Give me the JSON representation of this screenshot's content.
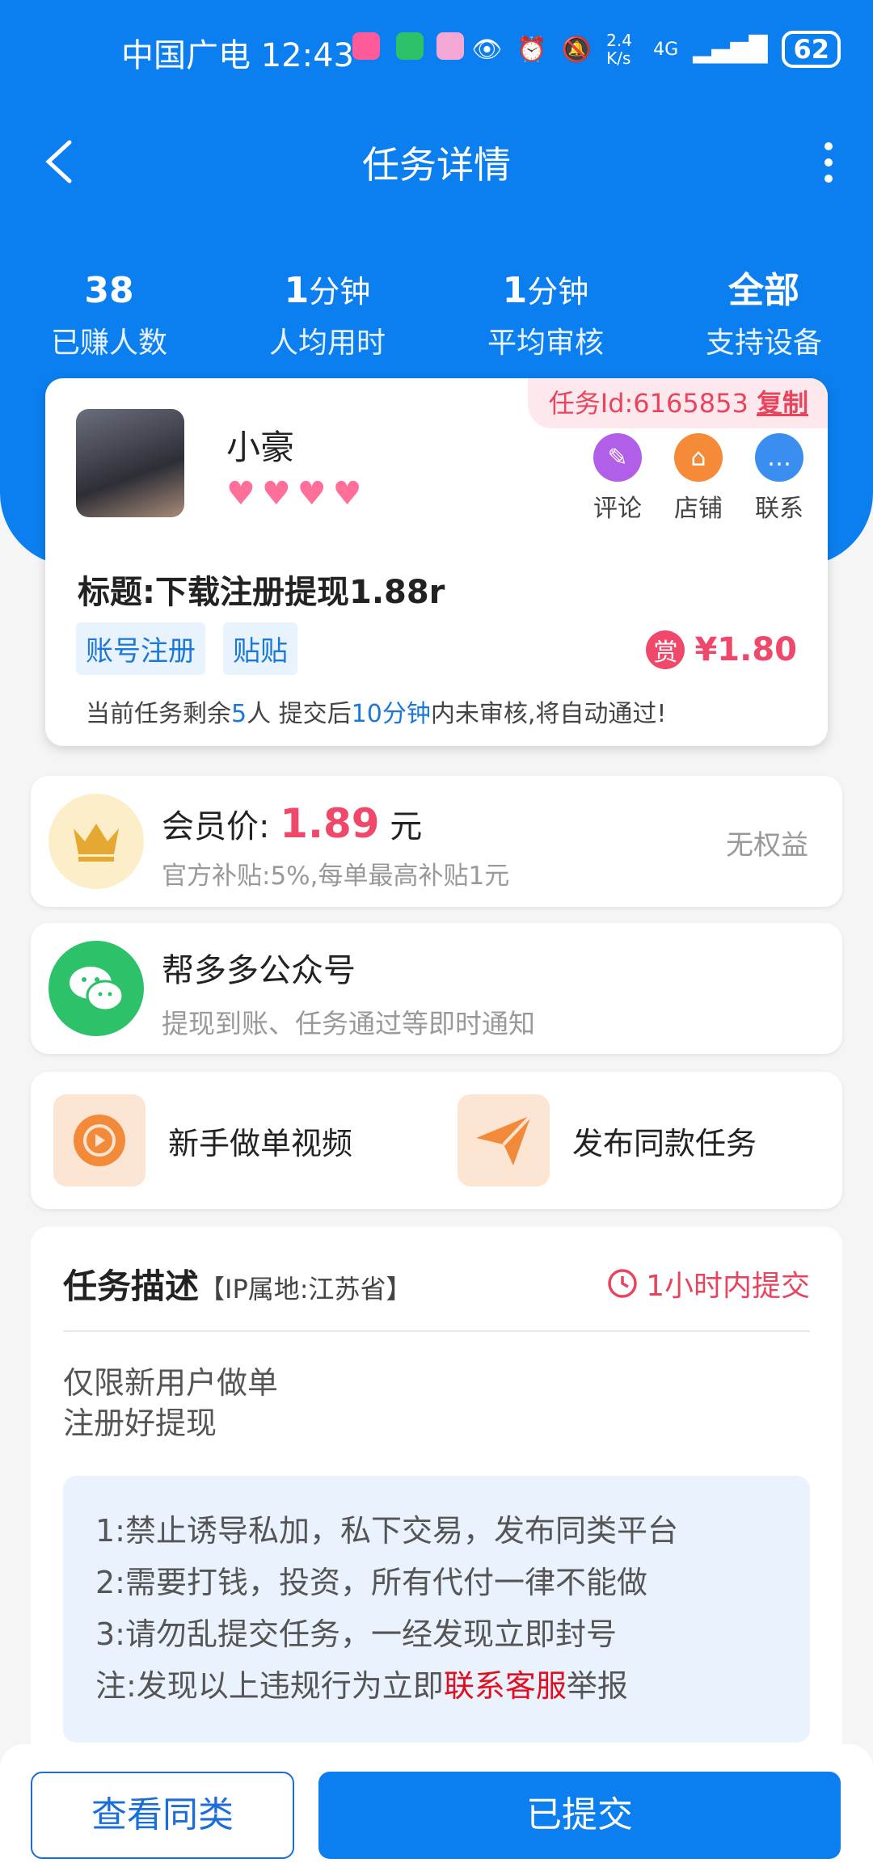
{
  "status": {
    "carrier": "中国广电",
    "time": "12:43",
    "speed": "2.4 K/s",
    "network": "4G",
    "battery": "62"
  },
  "nav": {
    "title": "任务详情"
  },
  "stats": [
    {
      "v": "38",
      "u": "",
      "l": "已赚人数"
    },
    {
      "v": "1",
      "u": "分钟",
      "l": "人均用时"
    },
    {
      "v": "1",
      "u": "分钟",
      "l": "平均审核"
    },
    {
      "v": "全部",
      "u": "",
      "l": "支持设备"
    }
  ],
  "task": {
    "id_label": "任务Id:6165853",
    "copy": "复制",
    "user": "小豪",
    "hearts": [
      "♥",
      "♥",
      "♥",
      "♥"
    ],
    "actions": [
      {
        "label": "评论",
        "icon": "comment-icon",
        "color": "#b15ee8"
      },
      {
        "label": "店铺",
        "icon": "shop-icon",
        "color": "#f58a38"
      },
      {
        "label": "联系",
        "icon": "chat-icon",
        "color": "#3a8ef0"
      }
    ],
    "title": "标题:下载注册提现1.88r",
    "tags": [
      "账号注册",
      "贴贴"
    ],
    "reward_badge": "赏",
    "price": "¥1.80",
    "tip_a": "当前任务剩余",
    "tip_b": "5",
    "tip_c": "人  提交后",
    "tip_d": "10分钟",
    "tip_e": "内未审核,将自动通过!"
  },
  "vip": {
    "label": "会员价:",
    "price": "1.89",
    "unit": "元",
    "sub": "官方补贴:5%,每单最高补贴1元",
    "right": "无权益"
  },
  "wechat": {
    "title": "帮多多公众号",
    "sub": "提现到账、任务通过等即时通知"
  },
  "links": {
    "video": "新手做单视频",
    "publish": "发布同款任务"
  },
  "desc": {
    "title": "任务描述",
    "ip": "【IP属地:江苏省】",
    "limit": "1小时内提交",
    "lines": [
      "仅限新用户做单",
      "注册好提现"
    ],
    "rules": [
      "1:禁止诱导私加，私下交易，发布同类平台",
      "2:需要打钱，投资，所有代付一律不能做",
      "3:请勿乱提交任务，一经发现立即封号"
    ],
    "note_a": "注:发现以上违规行为立即",
    "note_b": "联系客服",
    "note_c": "举报"
  },
  "buttons": {
    "similar": "查看同类",
    "submitted": "已提交"
  }
}
